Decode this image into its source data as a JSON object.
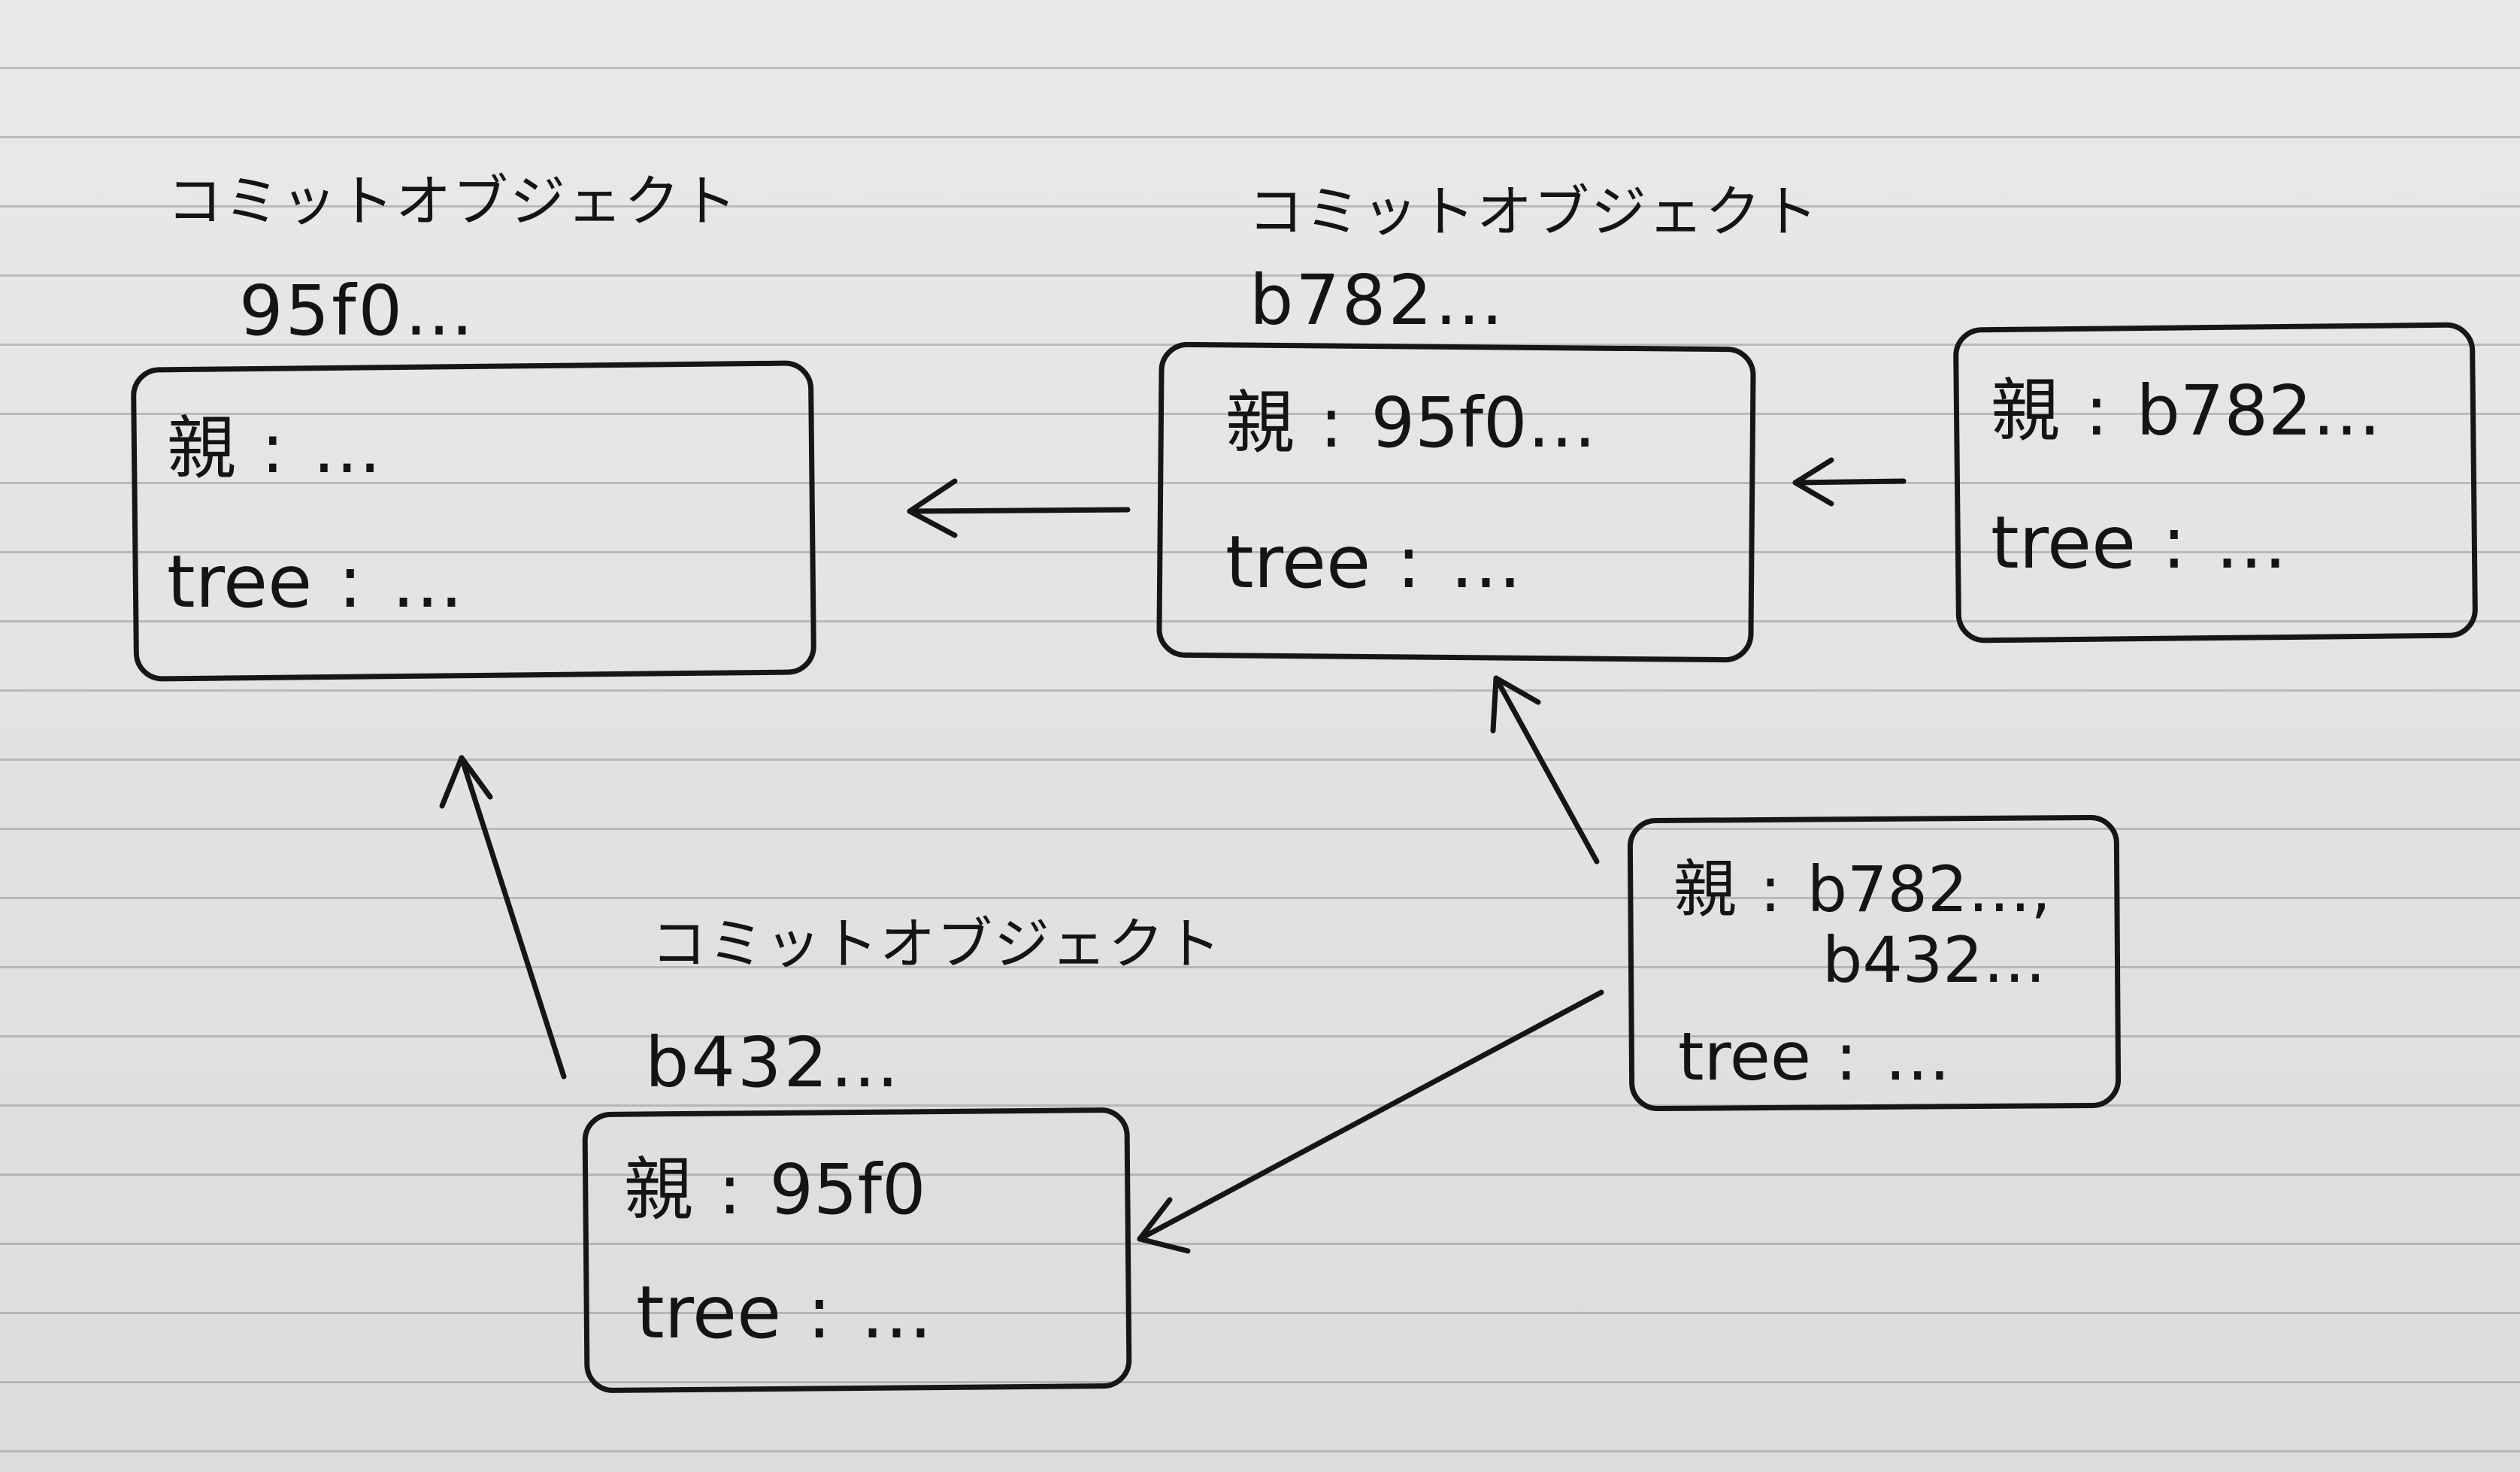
{
  "commits": [
    {
      "id": "commit-95f0",
      "label": "コミットオブジェクト",
      "hash": "95f0…",
      "parent_key": "親",
      "parent_sep": ":",
      "parent_value": "…",
      "tree_key": "tree",
      "tree_sep": ":",
      "tree_value": "…"
    },
    {
      "id": "commit-b782",
      "label": "コミットオブジェクト",
      "hash": "b782…",
      "parent_key": "親",
      "parent_sep": ":",
      "parent_value": "95f0…",
      "tree_key": "tree",
      "tree_sep": ":",
      "tree_value": "…"
    },
    {
      "id": "commit-b432",
      "label": "コミットオブジェクト",
      "hash": "b432…",
      "parent_key": "親",
      "parent_sep": ":",
      "parent_value": "95f0",
      "tree_key": "tree",
      "tree_sep": ":",
      "tree_value": "…"
    },
    {
      "id": "commit-child-of-b782",
      "parent_key": "親",
      "parent_sep": ":",
      "parent_value": "b782…",
      "tree_key": "tree",
      "tree_sep": ":",
      "tree_value": "…"
    },
    {
      "id": "commit-merge",
      "parent_key": "親",
      "parent_sep": ":",
      "parent_value": "b782…,",
      "parent_value_2": "b432…",
      "tree_key": "tree",
      "tree_sep": ":",
      "tree_value": "…"
    }
  ],
  "edges": [
    {
      "from": "commit-b782",
      "to": "commit-95f0"
    },
    {
      "from": "commit-child-of-b782",
      "to": "commit-b782"
    },
    {
      "from": "commit-b432",
      "to": "commit-95f0"
    },
    {
      "from": "commit-merge",
      "to": "commit-b782"
    },
    {
      "from": "commit-merge",
      "to": "commit-b432"
    }
  ],
  "colors": {
    "ink": "#151515",
    "paper": "#e4e4e2",
    "rule_lines": "#969696"
  }
}
